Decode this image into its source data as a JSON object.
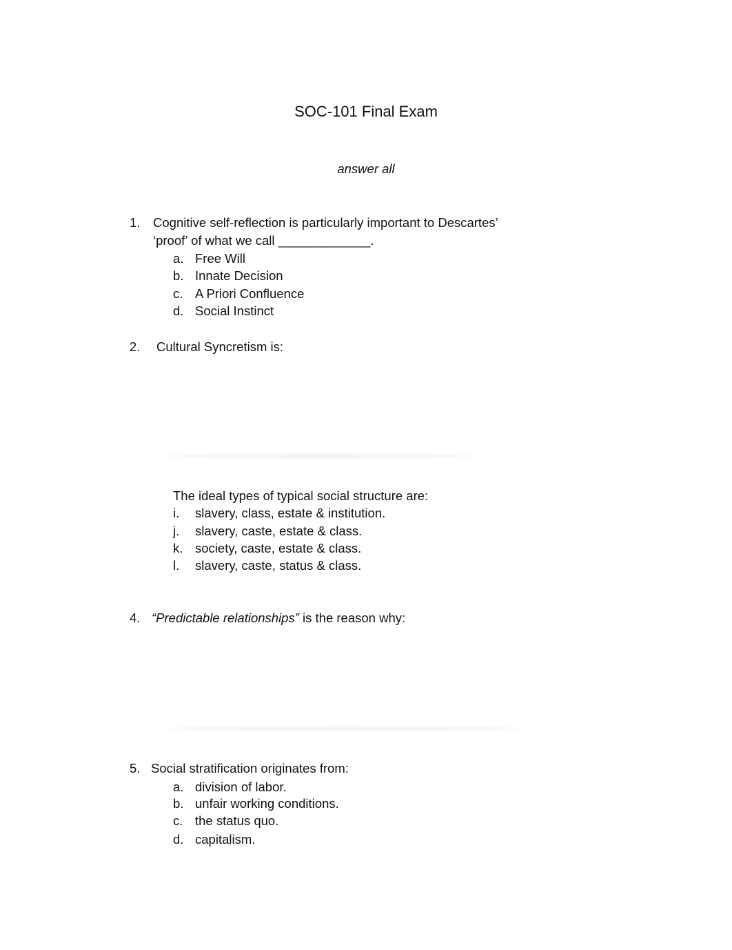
{
  "document": {
    "title": "SOC-101 Final Exam",
    "subtitle": "answer all"
  },
  "questions": [
    {
      "number": "1.",
      "text_line1": "Cognitive self-reflection is particularly important to Descartes’",
      "text_line2": "‘proof’ of what we call _____________.",
      "options": [
        {
          "letter": "a.",
          "text": "Free Will"
        },
        {
          "letter": "b.",
          "text": "Innate Decision"
        },
        {
          "letter": "c.",
          "text": "A Priori Confluence"
        },
        {
          "letter": "d.",
          "text": "Social Instinct"
        }
      ]
    },
    {
      "number": "2.",
      "text": "Cultural Syncretism is:"
    },
    {
      "number": "",
      "text": "The ideal types of typical social structure are:",
      "options": [
        {
          "letter": "i.",
          "text": "slavery, class, estate & institution."
        },
        {
          "letter": "j.",
          "text": "slavery, caste, estate & class."
        },
        {
          "letter": "k.",
          "text": "society, caste, estate & class."
        },
        {
          "letter": "l.",
          "text": "slavery, caste, status & class."
        }
      ]
    },
    {
      "number": "4.",
      "text_italic": "“Predictable relationships”",
      "text_rest": " is the reason why:"
    },
    {
      "number": "5.",
      "text": "Social stratification originates from:",
      "options": [
        {
          "letter": "a.",
          "text": "division of labor."
        },
        {
          "letter": "b.",
          "text": "unfair working conditions."
        },
        {
          "letter": "c.",
          "text": "the status quo."
        },
        {
          "letter": "d.",
          "text": "capitalism."
        }
      ]
    }
  ]
}
